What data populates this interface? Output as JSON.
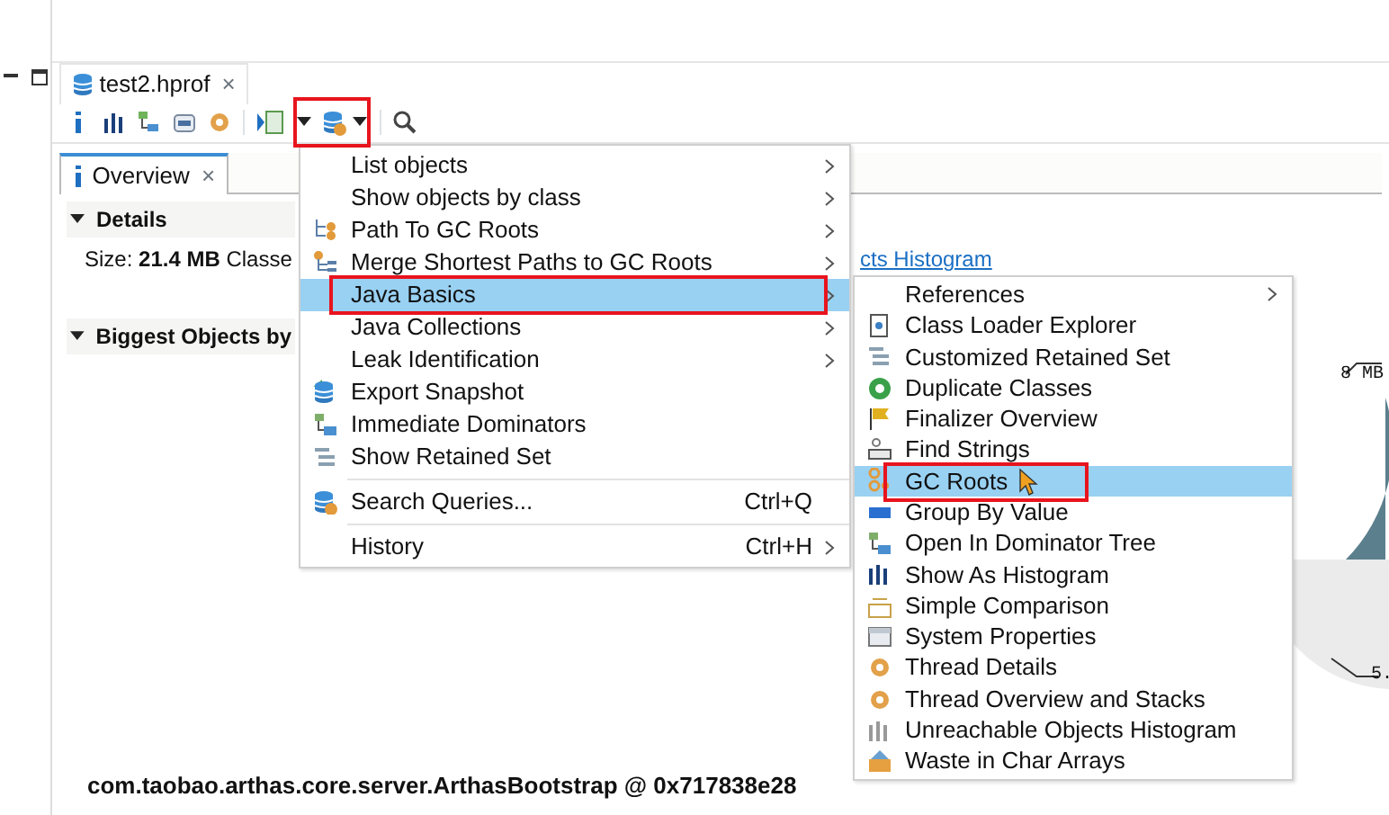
{
  "editor_tab": {
    "title": "test2.hprof",
    "close": "×"
  },
  "toolbar": {
    "query_button_highlighted": true
  },
  "overview_tab": {
    "label": "Overview",
    "close": "×",
    "selected": true
  },
  "details": {
    "title": "Details",
    "size_line": "Size: **21.4 MB** Classe",
    "link": "cts Histogram"
  },
  "biggest": {
    "title": "Biggest Objects by",
    "pie_labels": [
      "8 MB",
      "5."
    ],
    "caption": "com.taobao.arthas.core.server.ArthasBootstrap @ 0x717838e28"
  },
  "menu": [
    {
      "kind": "item",
      "label": "List objects",
      "submenu": true,
      "selected": false,
      "highlighted": false
    },
    {
      "kind": "item",
      "label": "Show objects by class",
      "submenu": true,
      "selected": false,
      "highlighted": false
    },
    {
      "kind": "item",
      "label": "Path To GC Roots",
      "submenu": true,
      "selected": false,
      "highlighted": false
    },
    {
      "kind": "item",
      "label": "Merge Shortest Paths to GC Roots",
      "submenu": true,
      "selected": false,
      "highlighted": false
    },
    {
      "kind": "item",
      "label": "Java Basics",
      "submenu": true,
      "selected": true,
      "highlighted": true
    },
    {
      "kind": "item",
      "label": "Java Collections",
      "submenu": true,
      "selected": false,
      "highlighted": false
    },
    {
      "kind": "item",
      "label": "Leak Identification",
      "submenu": true,
      "selected": false,
      "highlighted": false
    },
    {
      "kind": "item",
      "label": "Export Snapshot",
      "submenu": false,
      "selected": false,
      "highlighted": false
    },
    {
      "kind": "item",
      "label": "Immediate Dominators",
      "submenu": false,
      "selected": false,
      "highlighted": false
    },
    {
      "kind": "item",
      "label": "Show Retained Set",
      "submenu": false,
      "selected": false,
      "highlighted": false
    },
    {
      "kind": "separator"
    },
    {
      "kind": "item",
      "label": "Search Queries...",
      "shortcut": "Ctrl+Q",
      "submenu": false,
      "selected": false,
      "highlighted": false
    },
    {
      "kind": "separator"
    },
    {
      "kind": "item",
      "label": "History",
      "shortcut": "Ctrl+H",
      "submenu": true,
      "selected": false,
      "highlighted": false
    }
  ],
  "submenu": [
    {
      "label": "References",
      "submenu": true,
      "selected": false,
      "highlighted": false
    },
    {
      "label": "Class Loader Explorer",
      "submenu": false,
      "selected": false,
      "highlighted": false
    },
    {
      "label": "Customized Retained Set",
      "submenu": false,
      "selected": false,
      "highlighted": false
    },
    {
      "label": "Duplicate Classes",
      "submenu": false,
      "selected": false,
      "highlighted": false
    },
    {
      "label": "Finalizer Overview",
      "submenu": false,
      "selected": false,
      "highlighted": false
    },
    {
      "label": "Find Strings",
      "submenu": false,
      "selected": false,
      "highlighted": false
    },
    {
      "label": "GC Roots",
      "submenu": false,
      "selected": true,
      "highlighted": true
    },
    {
      "label": "Group By Value",
      "submenu": false,
      "selected": false,
      "highlighted": false
    },
    {
      "label": "Open In Dominator Tree",
      "submenu": false,
      "selected": false,
      "highlighted": false
    },
    {
      "label": "Show As Histogram",
      "submenu": false,
      "selected": false,
      "highlighted": false
    },
    {
      "label": "Simple Comparison",
      "submenu": false,
      "selected": false,
      "highlighted": false
    },
    {
      "label": "System Properties",
      "submenu": false,
      "selected": false,
      "highlighted": false
    },
    {
      "label": "Thread Details",
      "submenu": false,
      "selected": false,
      "highlighted": false
    },
    {
      "label": "Thread Overview and Stacks",
      "submenu": false,
      "selected": false,
      "highlighted": false
    },
    {
      "label": "Unreachable Objects Histogram",
      "submenu": false,
      "selected": false,
      "highlighted": false
    },
    {
      "label": "Waste in Char Arrays",
      "submenu": false,
      "selected": false,
      "highlighted": false
    }
  ]
}
